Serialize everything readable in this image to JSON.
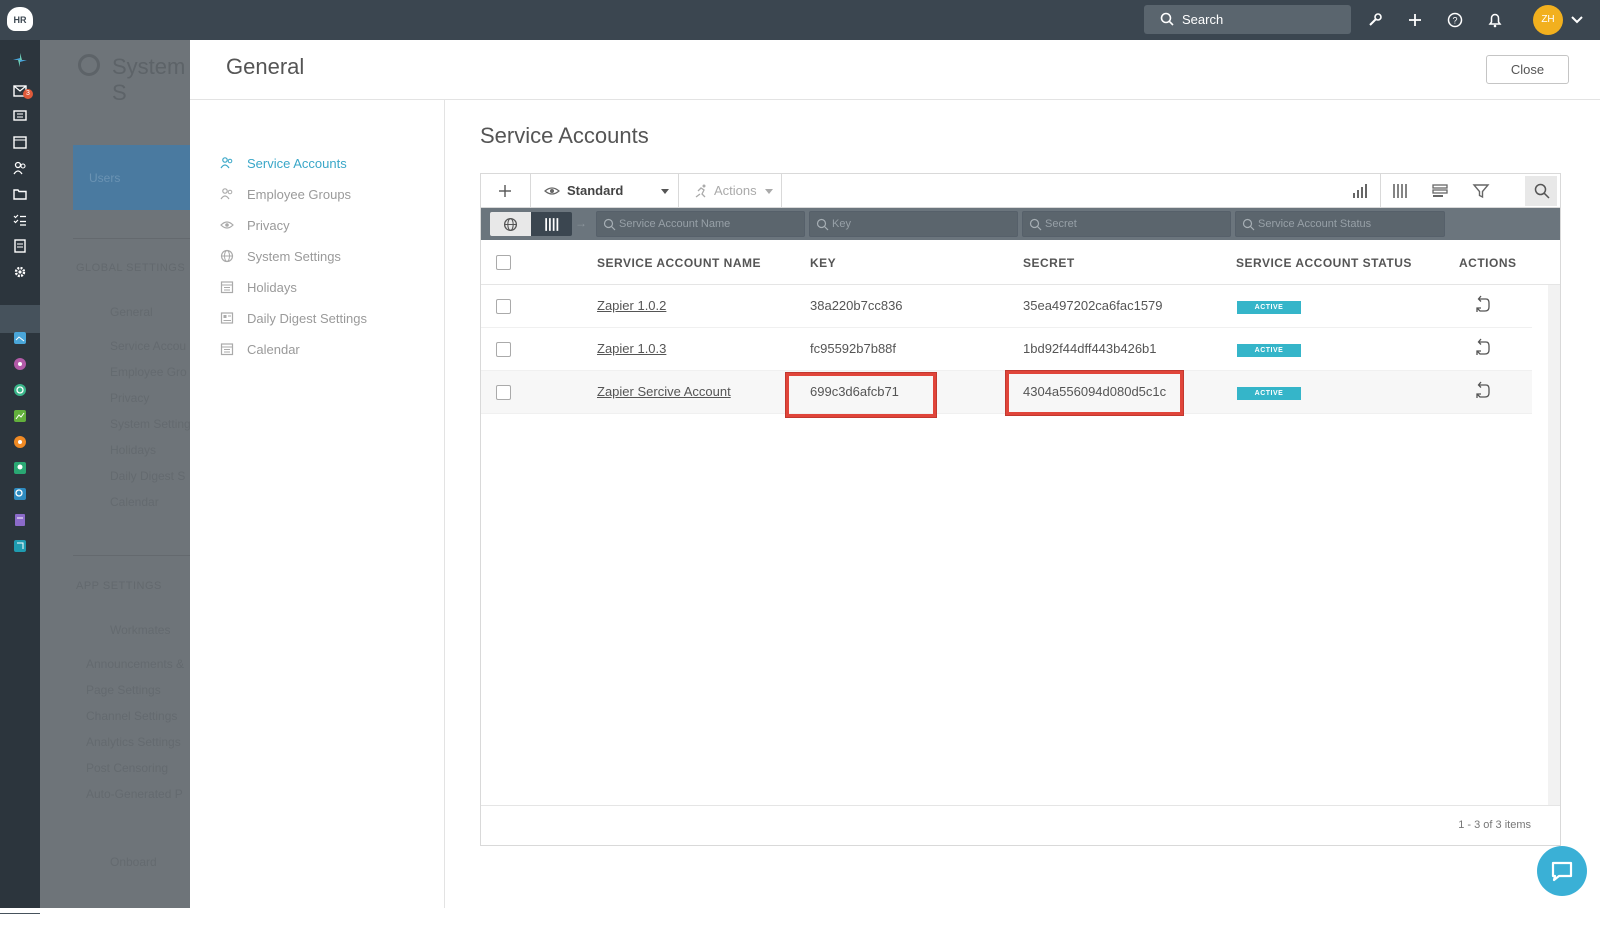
{
  "topbar": {
    "logo_text": "HR",
    "search_label": "Search",
    "avatar_initials": "ZH"
  },
  "rail": {
    "badge_count": "3"
  },
  "background_page": {
    "title": "System S",
    "users_card": "Users",
    "section_global": "GLOBAL SETTINGS",
    "items_global": [
      "General",
      "Service Accou",
      "Employee Gro",
      "Privacy",
      "System Setting",
      "Holidays",
      "Daily Digest S",
      "Calendar"
    ],
    "section_app": "APP SETTINGS",
    "workmates": "Workmates",
    "items_app": [
      "Announcements &",
      "Page Settings",
      "Channel Settings",
      "Analytics Settings",
      "Post Censoring",
      "Auto-Generated P"
    ],
    "onboard": "Onboard"
  },
  "panel": {
    "title": "General",
    "close_label": "Close"
  },
  "subnav": {
    "items": [
      {
        "label": "Service Accounts",
        "icon": "users-icon"
      },
      {
        "label": "Employee Groups",
        "icon": "users-icon"
      },
      {
        "label": "Privacy",
        "icon": "eye-icon"
      },
      {
        "label": "System Settings",
        "icon": "globe-icon"
      },
      {
        "label": "Holidays",
        "icon": "calendar-icon"
      },
      {
        "label": "Daily Digest Settings",
        "icon": "newspaper-icon"
      },
      {
        "label": "Calendar",
        "icon": "calendar-icon"
      }
    ]
  },
  "content": {
    "title": "Service Accounts",
    "toolbar": {
      "view_label": "Standard",
      "actions_label": "Actions"
    },
    "filters": {
      "name_placeholder": "Service Account Name",
      "key_placeholder": "Key",
      "secret_placeholder": "Secret",
      "status_placeholder": "Service Account Status"
    },
    "columns": {
      "name": "SERVICE ACCOUNT NAME",
      "key": "KEY",
      "secret": "SECRET",
      "status": "SERVICE ACCOUNT STATUS",
      "actions": "ACTIONS"
    },
    "rows": [
      {
        "name": "Zapier 1.0.2",
        "key": "38a220b7cc836",
        "secret": "35ea497202ca6fac1579",
        "status": "ACTIVE"
      },
      {
        "name": "Zapier 1.0.3",
        "key": "fc95592b7b88f",
        "secret": "1bd92f44dff443b426b1",
        "status": "ACTIVE"
      },
      {
        "name": "Zapier Sercive Account",
        "key": "699c3d6afcb71",
        "secret": "4304a556094d080d5c1c",
        "status": "ACTIVE"
      }
    ],
    "pagination": "1 - 3 of 3 items"
  },
  "colors": {
    "accent": "#3aa7c8",
    "status_active": "#35b5c9",
    "highlight": "#e0453a",
    "topbar": "#3b4650"
  }
}
